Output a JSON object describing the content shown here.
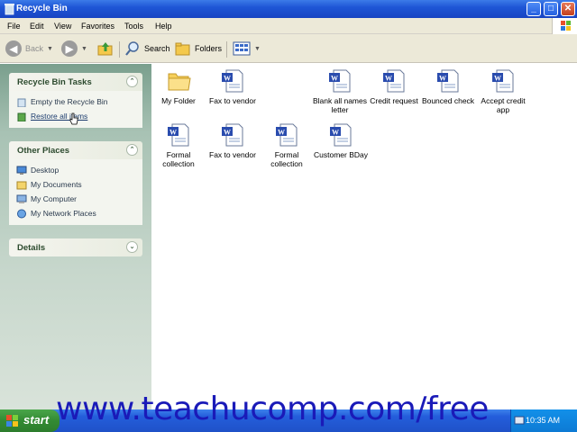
{
  "window": {
    "title": "Recycle Bin"
  },
  "menu": [
    "File",
    "Edit",
    "View",
    "Favorites",
    "Tools",
    "Help"
  ],
  "toolbar": {
    "back_label": "Back",
    "search_label": "Search",
    "folders_label": "Folders"
  },
  "sidebar": {
    "tasks": {
      "title": "Recycle Bin Tasks",
      "items": [
        {
          "label": "Empty the Recycle Bin",
          "icon": "recycle-bin-icon"
        },
        {
          "label": "Restore all items",
          "icon": "restore-icon"
        }
      ]
    },
    "places": {
      "title": "Other Places",
      "items": [
        {
          "label": "Desktop",
          "icon": "desktop-icon"
        },
        {
          "label": "My Documents",
          "icon": "my-documents-icon"
        },
        {
          "label": "My Computer",
          "icon": "my-computer-icon"
        },
        {
          "label": "My Network Places",
          "icon": "network-places-icon"
        }
      ]
    },
    "details": {
      "title": "Details"
    }
  },
  "files": [
    {
      "name": "My Folder",
      "type": "folder"
    },
    {
      "name": "Fax to vendor",
      "type": "word"
    },
    {
      "name": "Blank all names letter",
      "type": "word"
    },
    {
      "name": "Credit request",
      "type": "word"
    },
    {
      "name": "Bounced check",
      "type": "word"
    },
    {
      "name": "Accept credit app",
      "type": "word"
    },
    {
      "name": "Formal collection",
      "type": "word"
    },
    {
      "name": "Fax to vendor",
      "type": "word"
    },
    {
      "name": "Formal collection",
      "type": "word"
    },
    {
      "name": "Customer BDay",
      "type": "word"
    }
  ],
  "taskbar": {
    "start_label": "start",
    "clock": "10:35 AM"
  },
  "watermark": "www.teachucomp.com/free",
  "colors": {
    "titlebar": "#1e56d6",
    "sidebar": "#a8c2b4",
    "start": "#338a33",
    "watermark": "#1a1ab8"
  }
}
